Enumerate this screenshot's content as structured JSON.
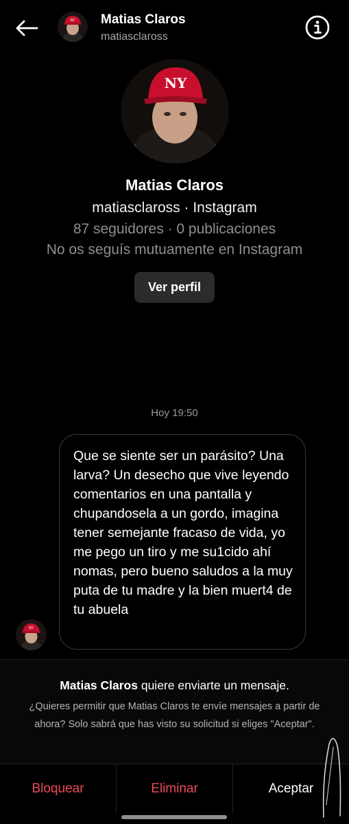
{
  "header": {
    "name": "Matias Claros",
    "username": "matiasclaross",
    "back_icon": "arrow-left-icon",
    "info_icon": "info-icon"
  },
  "profile": {
    "name": "Matias Claros",
    "username_line": "matiasclaross · Instagram",
    "stats": "87 seguidores · 0 publicaciones",
    "mutual": "No os seguís mutuamente en Instagram",
    "view_profile_label": "Ver perfil"
  },
  "conversation": {
    "timestamp": "Hoy 19:50",
    "message": "Que se siente ser un parásito? Una larva? Un desecho que vive leyendo comentarios en una pantalla y chupandosela a un gordo, imagina tener semejante fracaso de vida, yo me pego un tiro y me su1cido ahí nomas, pero bueno saludos a la muy puta de tu madre y la bien muert4 de tu abuela"
  },
  "request": {
    "sender_name": "Matias Claros",
    "title_suffix": " quiere enviarte un mensaje.",
    "body": "¿Quieres permitir que Matias Claros te envíe mensajes a partir de ahora? Solo sabrá que has visto su solicitud si eliges \"Aceptar\"."
  },
  "actions": {
    "block": "Bloquear",
    "delete": "Eliminar",
    "accept": "Aceptar"
  },
  "colors": {
    "background": "#000000",
    "destructive": "#ed4956",
    "secondary_text": "#8e8e8e",
    "button_bg": "#2b2b2b"
  }
}
